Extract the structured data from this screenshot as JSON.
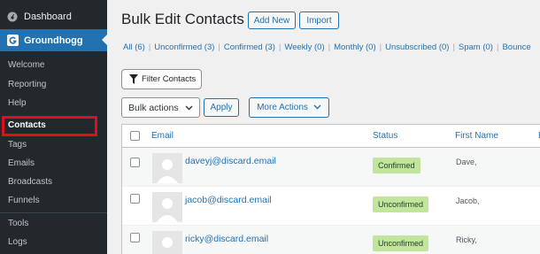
{
  "sidebar": {
    "dashboard": "Dashboard",
    "groundhogg": "Groundhogg",
    "items": [
      "Welcome",
      "Reporting",
      "Help",
      "Contacts",
      "Tags",
      "Emails",
      "Broadcasts",
      "Funnels"
    ],
    "items2": [
      "Tools",
      "Logs"
    ]
  },
  "header": {
    "title": "Bulk Edit Contacts",
    "add_new": "Add New",
    "import": "Import"
  },
  "views": [
    {
      "label": "All (6)"
    },
    {
      "label": "Unconfirmed (3)"
    },
    {
      "label": "Confirmed (3)"
    },
    {
      "label": "Weekly (0)"
    },
    {
      "label": "Monthly (0)"
    },
    {
      "label": "Unsubscribed (0)"
    },
    {
      "label": "Spam (0)"
    },
    {
      "label": "Bounce"
    }
  ],
  "toolbar": {
    "filter": "Filter Contacts",
    "bulk": "Bulk actions",
    "apply": "Apply",
    "more": "More Actions"
  },
  "table": {
    "headers": {
      "email": "Email",
      "status": "Status",
      "first_name": "First Name",
      "extra": "L"
    },
    "rows": [
      {
        "email": "daveyj@discard.email",
        "status": "Confirmed",
        "first_name": "Dave,"
      },
      {
        "email": "jacob@discard.email",
        "status": "Unconfirmed",
        "first_name": "Jacob,"
      },
      {
        "email": "ricky@discard.email",
        "status": "Unconfirmed",
        "first_name": "Ricky,"
      }
    ]
  },
  "colors": {
    "sidebar_bg": "#23282d",
    "accent": "#2271b1",
    "badge_green": "#c2e59c",
    "highlight_red": "#e0101a"
  }
}
